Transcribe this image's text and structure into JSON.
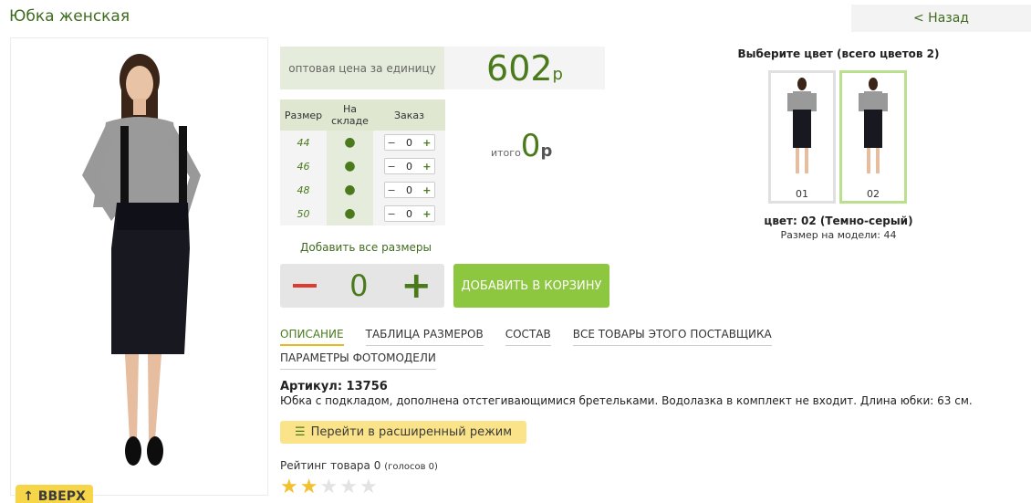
{
  "header": {
    "title": "Юбка женская",
    "back_label": "< Назад"
  },
  "price": {
    "label": "оптовая цена за единицу",
    "value": "602",
    "currency": "р"
  },
  "sizes_table": {
    "columns": [
      "Размер",
      "На складе",
      "Заказ"
    ],
    "rows": [
      {
        "size": "44",
        "stock": "●",
        "qty": "0"
      },
      {
        "size": "46",
        "stock": "●",
        "qty": "0"
      },
      {
        "size": "48",
        "stock": "●",
        "qty": "0"
      },
      {
        "size": "50",
        "stock": "●",
        "qty": "0"
      }
    ],
    "minus": "−",
    "plus": "+"
  },
  "total": {
    "label": "итого",
    "value": "0",
    "currency": "р"
  },
  "add_all_label": "Добавить все размеры",
  "quantity": {
    "value": "0",
    "plus": "+"
  },
  "cart_button_label": "ДОБАВИТЬ В КОРЗИНУ",
  "tabs": [
    "ОПИСАНИЕ",
    "ТАБЛИЦА РАЗМЕРОВ",
    "СОСТАВ",
    "ВСЕ ТОВАРЫ ЭТОГО ПОСТАВЩИКА",
    "ПАРАМЕТРЫ ФОТОМОДЕЛИ"
  ],
  "article": "Артикул: 13756",
  "description": "Юбка с подкладом, дополнена отстегивающимися бретельками. Водолазка в комплект не входит. Длина юбки: 63 см.",
  "advanced_mode_label": "Перейти в расширенный режим",
  "rating": {
    "text": "Рейтинг товара 0",
    "votes": "(голосов 0)",
    "stars_filled": 2,
    "stars_total": 5
  },
  "colors": {
    "heading": "Выберите цвет (всего цветов 2)",
    "swatches": [
      "01",
      "02"
    ],
    "selected_name": "цвет: 02 (Темно-серый)",
    "model_size": "Размер на модели: 44"
  },
  "up_button_label": "↑ ВВЕРХ",
  "palette": {
    "accent": "#4a7a1c",
    "cart": "#8dc63f",
    "minus": "#e03b2f",
    "header_bg": "#dfe7d1"
  }
}
